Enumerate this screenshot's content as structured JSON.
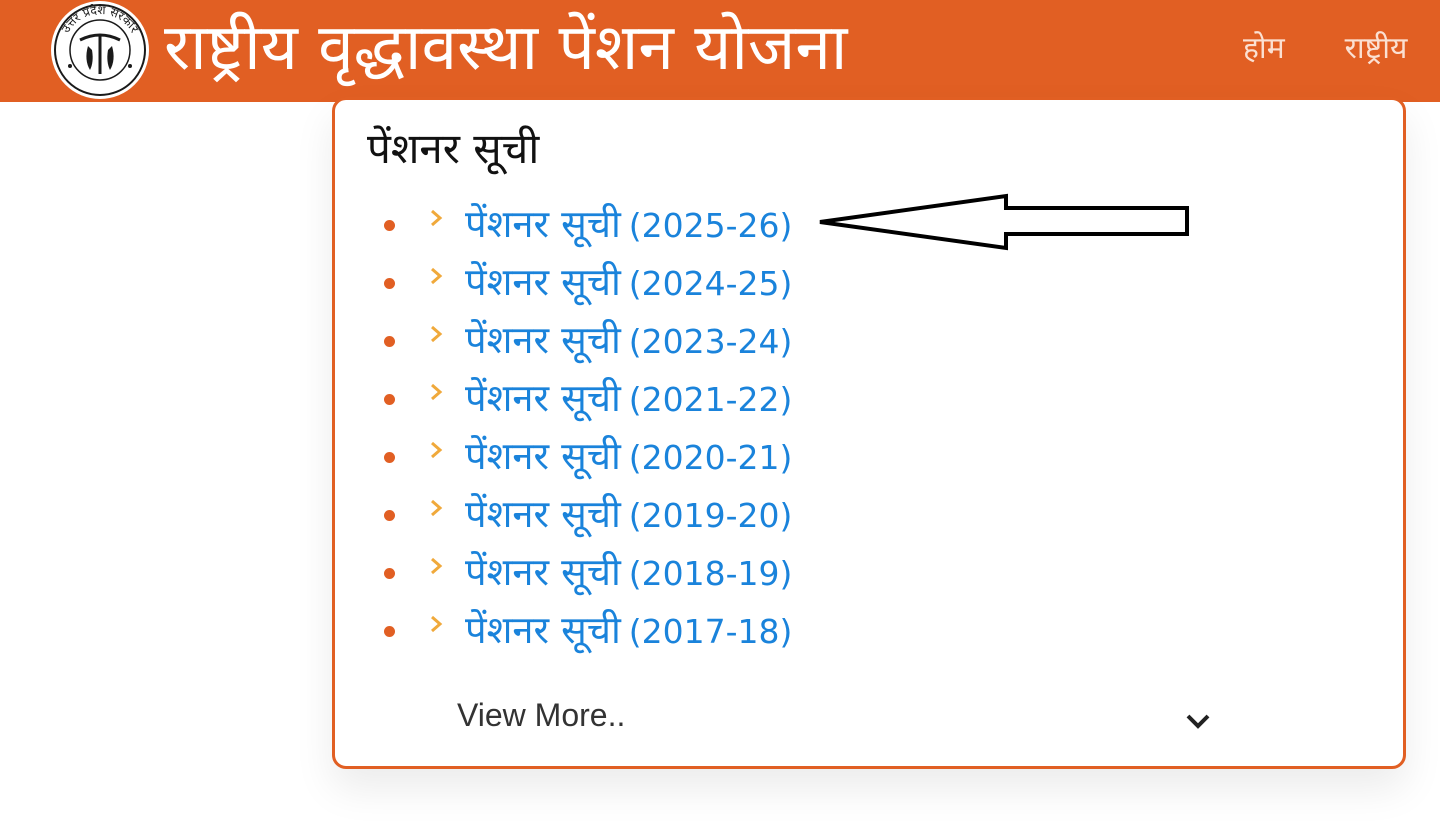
{
  "header": {
    "logo_text": "उत्तर प्रदेश सरकार",
    "title": "राष्ट्रीय वृद्धावस्था पेंशन योजना",
    "nav": [
      {
        "label": "होम"
      },
      {
        "label": "राष्ट्रीय"
      }
    ],
    "background_color": "#e15f23"
  },
  "card": {
    "title": "पेंशनर सूची",
    "items": [
      {
        "label": "पेंशनर सूची",
        "year": "(2025-26)"
      },
      {
        "label": "पेंशनर सूची",
        "year": "(2024-25)"
      },
      {
        "label": "पेंशनर सूची",
        "year": "(2023-24)"
      },
      {
        "label": "पेंशनर सूची",
        "year": "(2021-22)"
      },
      {
        "label": "पेंशनर सूची",
        "year": "(2020-21)"
      },
      {
        "label": "पेंशनर सूची",
        "year": "(2019-20)"
      },
      {
        "label": "पेंशनर सूची",
        "year": "(2018-19)"
      },
      {
        "label": "पेंशनर सूची",
        "year": "(2017-18)"
      }
    ],
    "view_more_label": "View More..",
    "view_more_icon": "chevron-down-icon",
    "item_icon": "chevron-right-icon",
    "link_color": "#1a83db",
    "accent_color": "#e15f23"
  },
  "annotation": {
    "icon": "left-arrow-icon",
    "points_to_item": 0
  }
}
